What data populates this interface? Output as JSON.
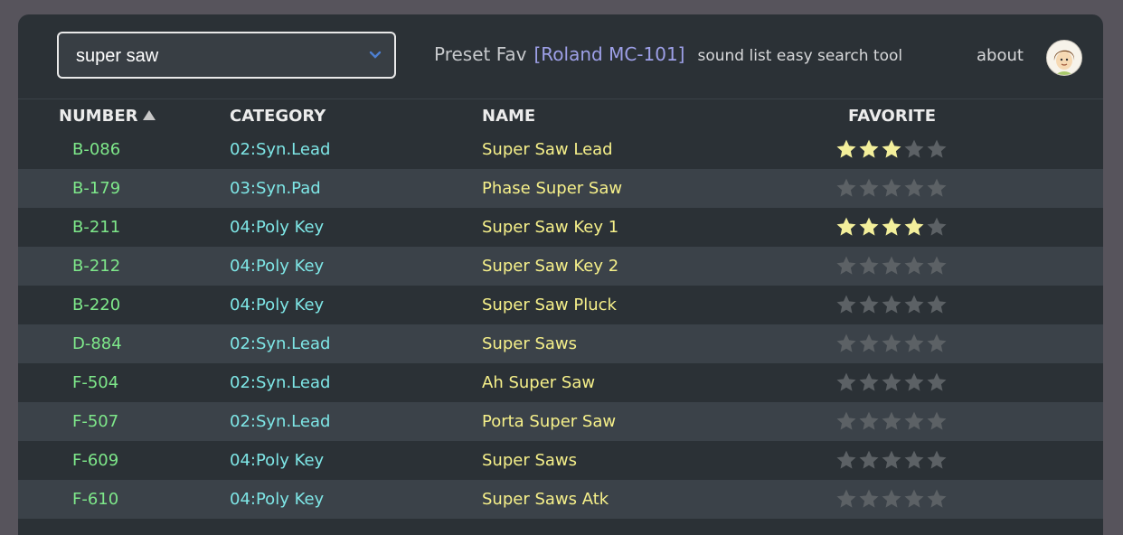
{
  "search": {
    "value": "super saw",
    "placeholder": ""
  },
  "brand": {
    "title": "Preset Fav",
    "device": "[Roland MC-101]",
    "subtitle": "sound list easy search tool"
  },
  "nav": {
    "about": "about"
  },
  "table": {
    "headers": {
      "number": "NUMBER",
      "category": "CATEGORY",
      "name": "NAME",
      "favorite": "FAVORITE"
    },
    "sort": {
      "column": "number",
      "direction": "ascending"
    },
    "rows": [
      {
        "number": "B-086",
        "category": "02:Syn.Lead",
        "name": "Super Saw Lead",
        "favorite": 3
      },
      {
        "number": "B-179",
        "category": "03:Syn.Pad",
        "name": "Phase Super Saw",
        "favorite": 0
      },
      {
        "number": "B-211",
        "category": "04:Poly Key",
        "name": "Super Saw Key 1",
        "favorite": 4
      },
      {
        "number": "B-212",
        "category": "04:Poly Key",
        "name": "Super Saw Key 2",
        "favorite": 0
      },
      {
        "number": "B-220",
        "category": "04:Poly Key",
        "name": "Super Saw Pluck",
        "favorite": 0
      },
      {
        "number": "D-884",
        "category": "02:Syn.Lead",
        "name": "Super Saws",
        "favorite": 0
      },
      {
        "number": "F-504",
        "category": "02:Syn.Lead",
        "name": "Ah Super Saw",
        "favorite": 0
      },
      {
        "number": "F-507",
        "category": "02:Syn.Lead",
        "name": "Porta Super Saw",
        "favorite": 0
      },
      {
        "number": "F-609",
        "category": "04:Poly Key",
        "name": "Super Saws",
        "favorite": 0
      },
      {
        "number": "F-610",
        "category": "04:Poly Key",
        "name": "Super Saws Atk",
        "favorite": 0
      }
    ],
    "max_stars": 5
  },
  "colors": {
    "star_on": "#f3ef9b",
    "star_off": "#5c6165",
    "number": "#7ee88a",
    "category": "#7ee6e6",
    "name": "#f6f08a",
    "device": "#9ea0e8"
  },
  "icons": {
    "dropdown": "chevron-down-icon",
    "sort": "sort-ascending-icon",
    "star": "star-icon",
    "avatar": "avatar-icon"
  }
}
